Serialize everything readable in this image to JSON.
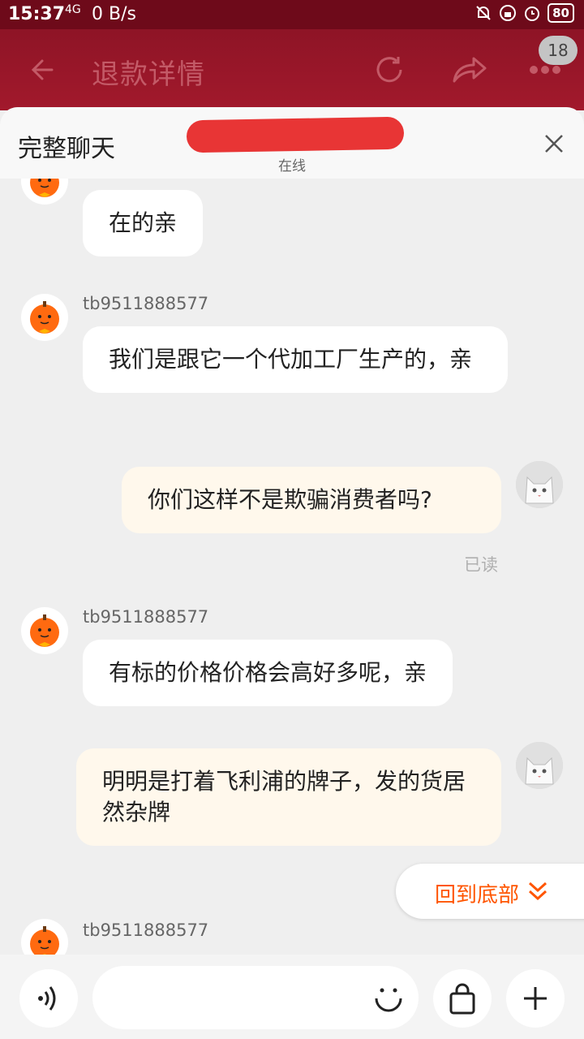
{
  "status_bar": {
    "time": "15:37",
    "network_type": "4G",
    "speed": "0 B/s",
    "battery": "80"
  },
  "header": {
    "title": "退款详情",
    "badge_count": "18"
  },
  "chat": {
    "title": "完整聊天",
    "status": "在线",
    "messages": [
      {
        "from": "shop",
        "text": "在的亲"
      },
      {
        "from": "shop",
        "sender": "tb9511888577",
        "text": "我们是跟它一个代加工厂生产的，亲"
      },
      {
        "from": "me",
        "text": "你们这样不是欺骗消费者吗?",
        "read": "已读"
      },
      {
        "from": "shop",
        "sender": "tb9511888577",
        "text": "有标的价格价格会高好多呢，亲"
      },
      {
        "from": "me",
        "text": "明明是打着飞利浦的牌子，发的货居然杂牌"
      },
      {
        "from": "shop",
        "sender": "tb9511888577",
        "text": ""
      }
    ],
    "back_to_bottom": "回到底部"
  },
  "input": {
    "placeholder": ""
  },
  "colors": {
    "accent": "#ff5500",
    "header_bg": "#8e1426",
    "shop_bubble": "#ffffff",
    "my_bubble": "#fff8ec"
  },
  "icons": [
    "back-arrow-icon",
    "refresh-icon",
    "share-icon",
    "more-icon",
    "close-icon",
    "voice-icon",
    "smiley-icon",
    "shopping-bag-icon",
    "plus-icon",
    "chevron-double-down-icon"
  ]
}
